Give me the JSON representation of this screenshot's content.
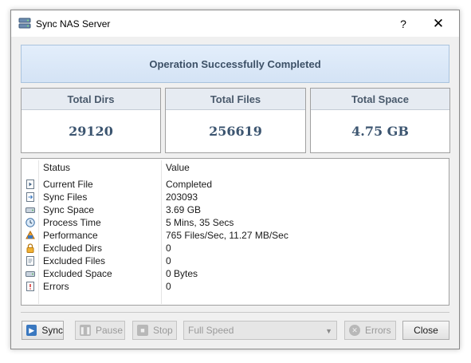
{
  "window": {
    "title": "Sync NAS Server",
    "help_label": "?",
    "close_label": "✕"
  },
  "banner": {
    "text": "Operation Successfully Completed"
  },
  "stats": {
    "dirs_label": "Total Dirs",
    "dirs_value": "29120",
    "files_label": "Total Files",
    "files_value": "256619",
    "space_label": "Total Space",
    "space_value": "4.75 GB"
  },
  "grid": {
    "status_header": "Status",
    "value_header": "Value",
    "rows": [
      {
        "key": "Current File",
        "value": "Completed",
        "icon": "file-play-icon"
      },
      {
        "key": "Sync Files",
        "value": "203093",
        "icon": "sync-files-icon"
      },
      {
        "key": "Sync Space",
        "value": "3.69 GB",
        "icon": "drive-icon"
      },
      {
        "key": "Process Time",
        "value": "5 Mins, 35 Secs",
        "icon": "clock-icon"
      },
      {
        "key": "Performance",
        "value": "765 Files/Sec, 11.27 MB/Sec",
        "icon": "performance-icon"
      },
      {
        "key": "Excluded Dirs",
        "value": "0",
        "icon": "lock-icon"
      },
      {
        "key": "Excluded Files",
        "value": "0",
        "icon": "excluded-file-icon"
      },
      {
        "key": "Excluded Space",
        "value": "0 Bytes",
        "icon": "drive-icon"
      },
      {
        "key": "Errors",
        "value": "0",
        "icon": "error-icon"
      }
    ]
  },
  "toolbar": {
    "sync_label": "Sync",
    "pause_label": "Pause",
    "stop_label": "Stop",
    "speed_value": "Full Speed",
    "errors_label": "Errors",
    "close_label": "Close"
  },
  "colors": {
    "banner_bg": "#dbe8f7",
    "banner_text": "#3c5066",
    "stat_value": "#3c5570",
    "window_bg": "#f0f0f0"
  }
}
